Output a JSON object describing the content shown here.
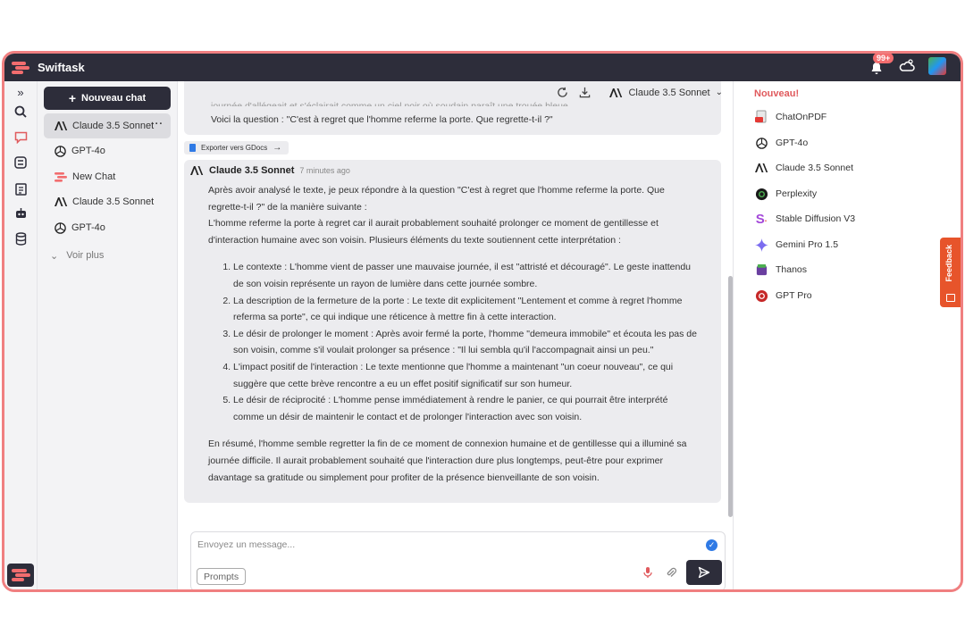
{
  "app": {
    "brand": "Swiftask",
    "notification_count": "99+"
  },
  "sidebar": {
    "new_chat_label": "Nouveau chat",
    "items": [
      {
        "label": "Claude 3.5 Sonnet",
        "icon": "anthropic-icon",
        "selected": true
      },
      {
        "label": "GPT-4o",
        "icon": "openai-icon"
      },
      {
        "label": "New Chat",
        "icon": "swiftask-icon"
      },
      {
        "label": "Claude 3.5 Sonnet",
        "icon": "anthropic-icon"
      },
      {
        "label": "GPT-4o",
        "icon": "openai-icon"
      }
    ],
    "more_label": "Voir plus"
  },
  "main": {
    "model_selector": "Claude 3.5 Sonnet",
    "user_message": {
      "faded_text": "journée d'allégeait et s'éclairait comme un ciel noir où soudain paraît une trouée bleue.",
      "question": "Voici la question : \"C'est à regret que l'homme referme la porte. Que regrette-t-il ?\""
    },
    "export_label": "Exporter vers GDocs",
    "ai_message": {
      "author": "Claude 3.5 Sonnet",
      "time": "7 minutes ago",
      "intro": "Après avoir analysé le texte, je peux répondre à la question \"C'est à regret que l'homme referme la porte. Que regrette-t-il ?\" de la manière suivante :",
      "intro2": "L'homme referme la porte à regret car il aurait probablement souhaité prolonger ce moment de gentillesse et d'interaction humaine avec son voisin. Plusieurs éléments du texte soutiennent cette interprétation :",
      "points": [
        "Le contexte : L'homme vient de passer une mauvaise journée, il est \"attristé et découragé\". Le geste inattendu de son voisin représente un rayon de lumière dans cette journée sombre.",
        "La description de la fermeture de la porte : Le texte dit explicitement \"Lentement et comme à regret l'homme referma sa porte\", ce qui indique une réticence à mettre fin à cette interaction.",
        "Le désir de prolonger le moment : Après avoir fermé la porte, l'homme \"demeura immobile\" et écouta les pas de son voisin, comme s'il voulait prolonger sa présence : \"Il lui sembla qu'il l'accompagnait ainsi un peu.\"",
        "L'impact positif de l'interaction : Le texte mentionne que l'homme a maintenant \"un coeur nouveau\", ce qui suggère que cette brève rencontre a eu un effet positif significatif sur son humeur.",
        "Le désir de réciprocité : L'homme pense immédiatement à rendre le panier, ce qui pourrait être interprété comme un désir de maintenir le contact et de prolonger l'interaction avec son voisin."
      ],
      "summary": "En résumé, l'homme semble regretter la fin de ce moment de connexion humaine et de gentillesse qui a illuminé sa journée difficile. Il aurait probablement souhaité que l'interaction dure plus longtemps, peut-être pour exprimer davantage sa gratitude ou simplement pour profiter de la présence bienveillante de son voisin."
    },
    "input": {
      "placeholder": "Envoyez un message...",
      "value": ""
    },
    "prompts_label": "Prompts"
  },
  "right_panel": {
    "title": "Nouveau!",
    "models": [
      {
        "label": "ChatOnPDF",
        "icon": "pdf-icon"
      },
      {
        "label": "GPT-4o",
        "icon": "openai-icon"
      },
      {
        "label": "Claude 3.5 Sonnet",
        "icon": "anthropic-icon"
      },
      {
        "label": "Perplexity",
        "icon": "perplexity-icon"
      },
      {
        "label": "Stable Diffusion V3",
        "icon": "stable-diffusion-icon"
      },
      {
        "label": "Gemini Pro 1.5",
        "icon": "gemini-icon"
      },
      {
        "label": "Thanos",
        "icon": "thanos-icon"
      },
      {
        "label": "GPT Pro",
        "icon": "gpt-pro-icon"
      }
    ]
  },
  "feedback_label": "Feedback",
  "colors": {
    "accent": "#e05a5d",
    "dark": "#2d2d3a",
    "frame": "#f07f80",
    "feedback": "#e7542b"
  }
}
